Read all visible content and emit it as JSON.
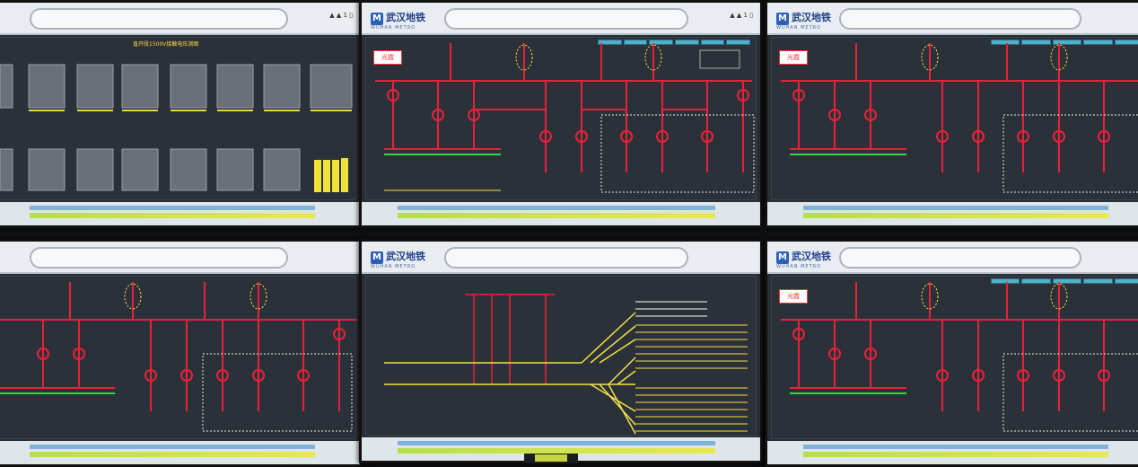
{
  "scene": "control-room-video-wall",
  "brand": {
    "name": "武汉地铁",
    "sub": "WUHAN METRO"
  },
  "screens": [
    {
      "id": "top-left",
      "heading": "直开段1500V接触电压测图"
    },
    {
      "id": "top-center",
      "tag": "光霞"
    },
    {
      "id": "top-right",
      "tag": "光霞"
    },
    {
      "id": "bottom-left"
    },
    {
      "id": "bottom-center"
    },
    {
      "id": "bottom-right",
      "tag": "光霞"
    }
  ],
  "colors": {
    "background": "#2b3138",
    "busbar": "#e8213a",
    "feeder": "#f5e04a",
    "energized": "#39d24a",
    "accent": "#4fb0c9",
    "header": "#e9edf1"
  }
}
